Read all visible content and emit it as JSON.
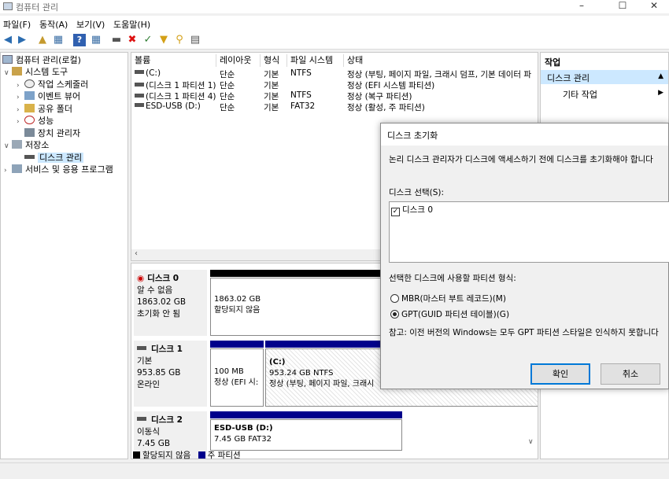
{
  "window": {
    "title": "컴퓨터 관리"
  },
  "menu": [
    "파일(F)",
    "동작(A)",
    "보기(V)",
    "도움말(H)"
  ],
  "tree": {
    "root": "컴퓨터 관리(로컬)",
    "system_tools": "시스템 도구",
    "task_scheduler": "작업 스케줄러",
    "event_viewer": "이벤트 뷰어",
    "shared_folders": "공유 폴더",
    "performance": "성능",
    "device_manager": "장치 관리자",
    "storage": "저장소",
    "disk_management": "디스크 관리",
    "services": "서비스 및 응용 프로그램"
  },
  "volumes": {
    "columns": [
      "볼륨",
      "레이아웃",
      "형식",
      "파일 시스템",
      "상태"
    ],
    "rows": [
      [
        "(C:)",
        "단순",
        "기본",
        "NTFS",
        "정상 (부팅, 페이지 파일, 크래시 덤프, 기본 데이터 파"
      ],
      [
        "(디스크 1 파티션 1)",
        "단순",
        "기본",
        "",
        "정상 (EFI 시스템 파티션)"
      ],
      [
        "(디스크 1 파티션 4)",
        "단순",
        "기본",
        "NTFS",
        "정상 (복구 파티션)"
      ],
      [
        "ESD-USB (D:)",
        "단순",
        "기본",
        "FAT32",
        "정상 (활성, 주 파티션)"
      ]
    ]
  },
  "disks": {
    "disk0": {
      "name": "디스크 0",
      "type": "알 수 없음",
      "size": "1863.02 GB",
      "status": "초기화 안 됨",
      "part_size": "1863.02 GB",
      "part_state": "할당되지 않음"
    },
    "disk1": {
      "name": "디스크 1",
      "type": "기본",
      "size": "953.85 GB",
      "status": "온라인",
      "p1_size": "100 MB",
      "p1_state": "정상 (EFI 시:",
      "p2_name": "(C:)",
      "p2_size": "953.24 GB NTFS",
      "p2_state": "정상 (부팅, 페이지 파일, 크래시"
    },
    "disk2": {
      "name": "디스크 2",
      "type": "이동식",
      "size": "7.45 GB",
      "p_name": "ESD-USB (D:)",
      "p_size": "7.45 GB FAT32"
    }
  },
  "legend": {
    "unallocated": "할당되지 않음",
    "primary": "주 파티션"
  },
  "actions": {
    "header": "작업",
    "section": "디스크 관리",
    "more": "기타 작업"
  },
  "dialog": {
    "title": "디스크 초기화",
    "message": "논리 디스크 관리자가 디스크에 액세스하기 전에 디스크를 초기화해야 합니다",
    "select_label": "디스크 선택(S):",
    "disk_item": "디스크 0",
    "style_label": "선택한 디스크에 사용할 파티션 형식:",
    "mbr": "MBR(마스터 부트 레코드)(M)",
    "gpt": "GPT(GUID 파티션 테이블)(G)",
    "note": "참고: 이전 버전의 Windows는 모두 GPT 파티션 스타일은 인식하지 못합니다",
    "ok": "확인",
    "cancel": "취소"
  },
  "colors": {
    "unallocated": "#000000",
    "primary": "#00008b",
    "accent": "#0078d7",
    "selected": "#cce8ff"
  }
}
